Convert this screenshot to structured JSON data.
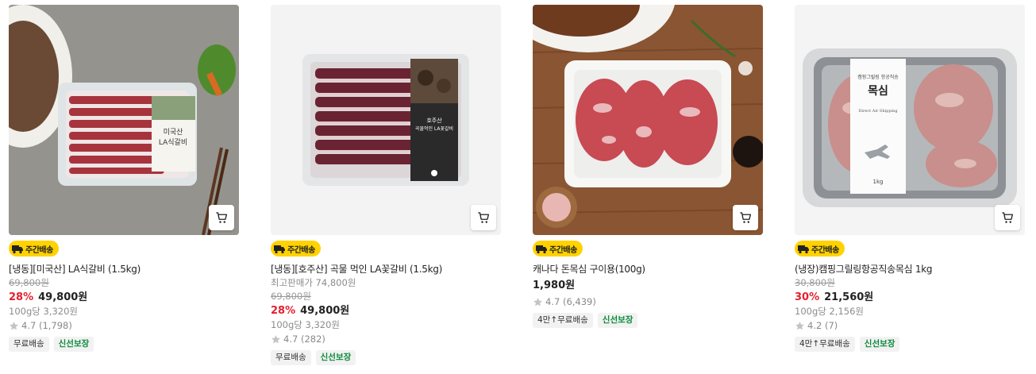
{
  "products": [
    {
      "badge": "주간배송",
      "title": "[냉동][미국산] LA식갈비 (1.5kg)",
      "original_price": "69,800원",
      "discount": "28%",
      "price": "49,800원",
      "unit_price": "100g당 3,320원",
      "rating": "4.7",
      "reviews": "(1,798)",
      "tags": [
        "무료배송",
        "신선보장"
      ],
      "package_label": "미국산\nLA식갈비"
    },
    {
      "badge": "주간배송",
      "title": "[냉동][호주산] 곡물 먹인 LA꽃갈비 (1.5kg)",
      "highest_price": "최고판매가 74,800원",
      "original_price": "69,800원",
      "discount": "28%",
      "price": "49,800원",
      "unit_price": "100g당 3,320원",
      "rating": "4.7",
      "reviews": "(282)",
      "tags": [
        "무료배송",
        "신선보장"
      ]
    },
    {
      "badge": "주간배송",
      "title": "캐나다 돈목심 구이용(100g)",
      "price": "1,980원",
      "rating": "4.7",
      "reviews": "(6,439)",
      "tags": [
        "4만↑무료배송",
        "신선보장"
      ]
    },
    {
      "badge": "주간배송",
      "title": "(냉장)캠핑그릴링항공직송목심 1kg",
      "original_price": "30,800원",
      "discount": "30%",
      "price": "21,560원",
      "unit_price": "100g당 2,156원",
      "rating": "4.2",
      "reviews": "(7)",
      "tags": [
        "4만↑무료배송",
        "신선보장"
      ],
      "package_label": "목심"
    }
  ],
  "colors": {
    "discount": "#e5202f",
    "badge_bg": "#ffd200",
    "fresh_tag": "#0a8a3a",
    "star": "#c4c4c4"
  },
  "icons": {
    "cart": "cart-icon",
    "truck": "truck-icon",
    "star": "star-icon"
  }
}
